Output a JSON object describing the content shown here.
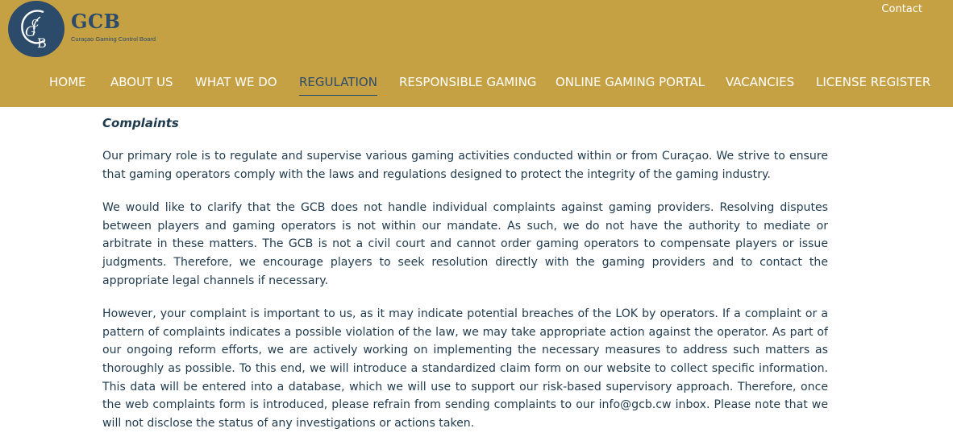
{
  "header": {
    "logo_letters": "GCB",
    "brand_name": "GCB",
    "brand_subtitle": "Curaçao Gaming Control Board",
    "contact_label": "Contact"
  },
  "nav": {
    "items": [
      {
        "label": "HOME",
        "active": false
      },
      {
        "label": "ABOUT US",
        "active": false
      },
      {
        "label": "WHAT WE DO",
        "active": false
      },
      {
        "label": "REGULATION",
        "active": true
      },
      {
        "label": "RESPONSIBLE GAMING",
        "active": false
      },
      {
        "label": "ONLINE GAMING PORTAL",
        "active": false
      },
      {
        "label": "VACANCIES",
        "active": false
      },
      {
        "label": "LICENSE REGISTER",
        "active": false
      }
    ]
  },
  "content": {
    "heading": "Complaints",
    "paragraphs": [
      "Our primary role is to regulate and supervise various gaming activities conducted within or from Curaçao. We strive to ensure that gaming operators comply with the laws and regulations designed to protect the integrity of the gaming industry.",
      "We would like to clarify that the GCB does not handle individual complaints against gaming providers. Resolving disputes between players and gaming operators is not within our mandate. As such, we do not have the authority to mediate or arbitrate in these matters. The GCB is not a civil court and cannot order gaming operators to compensate players or issue judgments. Therefore, we encourage players to seek resolution directly with the gaming providers and to contact the appropriate legal channels if necessary.",
      "However, your complaint is important to us, as it may indicate potential breaches of the LOK by operators. If a complaint or a pattern of complaints indicates a possible violation of the law, we may take appropriate action against the operator. As part of our ongoing reform efforts, we are actively working on implementing the necessary measures to address such matters as thoroughly as possible. To this end, we will introduce a standardized claim form on our website to collect specific information. This data will be entered into a database, which we will use to support our risk-based supervisory approach. Therefore, once the web complaints form is introduced, please refrain from sending complaints to our info@gcb.cw inbox. Please note that we will not disclose the status of any investigations or actions taken."
    ]
  },
  "colors": {
    "header_bg": "#c6a144",
    "brand_navy": "#2c4b6b",
    "text": "#1f3a4d"
  }
}
